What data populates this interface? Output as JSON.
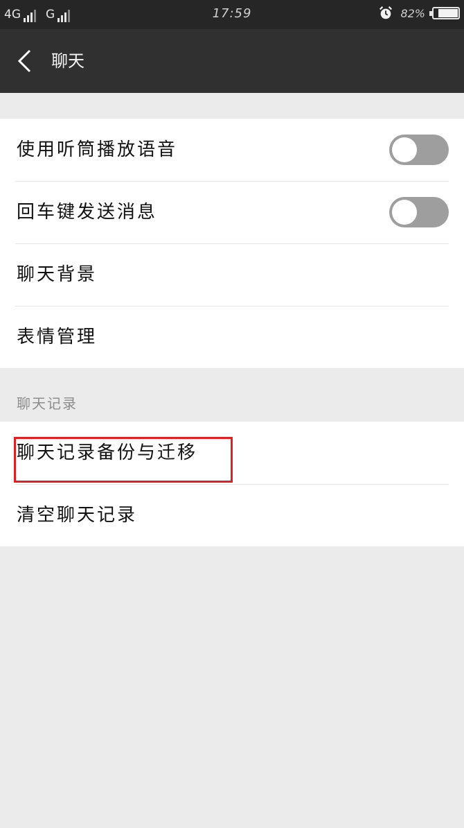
{
  "status_bar": {
    "network_1": "4G",
    "network_2": "G",
    "time": "17:59",
    "battery_percent_text": "82%",
    "battery_level": 0.82
  },
  "header": {
    "title": "聊天",
    "back_icon": "chevron-left-icon"
  },
  "settings": {
    "items": [
      {
        "label": "使用听筒播放语音",
        "toggle": false
      },
      {
        "label": "回车键发送消息",
        "toggle": false
      },
      {
        "label": "聊天背景"
      },
      {
        "label": "表情管理"
      }
    ]
  },
  "history": {
    "section_title": "聊天记录",
    "items": [
      {
        "label": "聊天记录备份与迁移",
        "highlighted": true
      },
      {
        "label": "清空聊天记录"
      }
    ]
  },
  "colors": {
    "status_bar_bg": "#262626",
    "title_bar_bg": "#303030",
    "page_bg": "#ebebeb",
    "toggle_off": "#9e9e9e",
    "highlight_border": "#e02020"
  }
}
